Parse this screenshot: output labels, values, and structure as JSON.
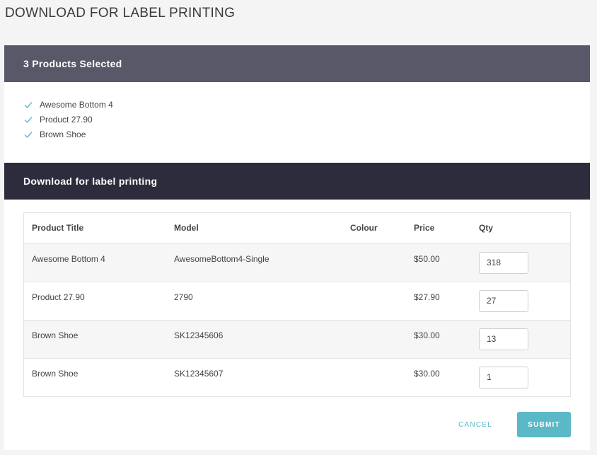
{
  "page": {
    "title": "DOWNLOAD FOR LABEL PRINTING"
  },
  "selected": {
    "header": "3 Products Selected",
    "items": [
      "Awesome Bottom 4",
      "Product 27.90",
      "Brown Shoe"
    ],
    "check_color": "#5bb8c6"
  },
  "download": {
    "header": "Download for label printing",
    "columns": [
      "Product Title",
      "Model",
      "Colour",
      "Price",
      "Qty"
    ],
    "rows": [
      {
        "title": "Awesome Bottom 4",
        "model": "AwesomeBottom4-Single",
        "colour": "",
        "price": "$50.00",
        "qty": "318"
      },
      {
        "title": "Product 27.90",
        "model": "2790",
        "colour": "",
        "price": "$27.90",
        "qty": "27"
      },
      {
        "title": "Brown Shoe",
        "model": "SK12345606",
        "colour": "",
        "price": "$30.00",
        "qty": "13"
      },
      {
        "title": "Brown Shoe",
        "model": "SK12345607",
        "colour": "",
        "price": "$30.00",
        "qty": "1"
      }
    ],
    "cancel_label": "CANCEL",
    "submit_label": "SUBMIT"
  },
  "colors": {
    "accent": "#5bb8c6",
    "header_light": "#585868",
    "header_dark": "#2c2c3c"
  }
}
